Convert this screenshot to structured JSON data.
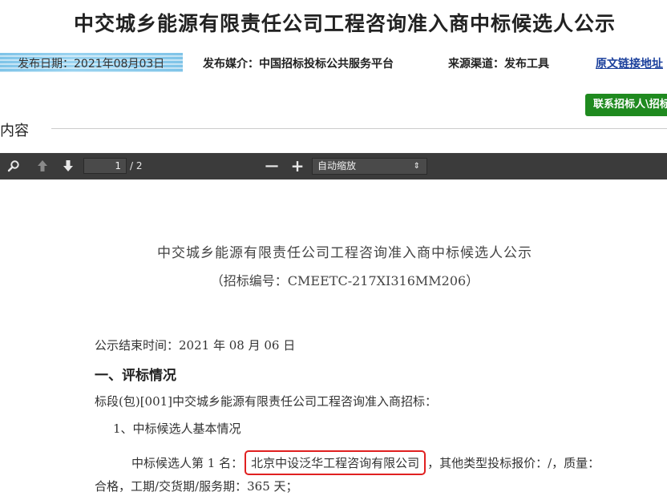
{
  "header": {
    "title": "中交城乡能源有限责任公司工程咨询准入商中标候选人公示",
    "publish_date": "发布日期：2021年08月03日",
    "media": "发布媒介：中国招标投标公共服务平台",
    "source": "来源渠道：发布工具",
    "original_link": "原文链接地址",
    "contact_button": "联系招标人\\招标",
    "section_label": "内容"
  },
  "pdf_toolbar": {
    "current_page": "1",
    "total_pages": "/ 2",
    "zoom": "自动缩放",
    "icons": [
      "search-icon",
      "previous-page-icon",
      "next-page-icon",
      "zoom-out-icon",
      "zoom-in-icon",
      "chevron-updown-icon"
    ],
    "zoom_out_symbol": "—",
    "zoom_in_symbol": "+"
  },
  "document": {
    "title": "中交城乡能源有限责任公司工程咨询准入商中标候选人公示",
    "code": "（招标编号：CMEETC-217XI316MM206）",
    "notice_end": "公示结束时间：2021 年 08 月 06 日",
    "heading_1": "一、评标情况",
    "section_line": "标段(包)[001]中交城乡能源有限责任公司工程咨询准入商招标：",
    "sub_heading": "1、中标候选人基本情况",
    "candidate_prefix": "中标候选人第 1 名：",
    "candidate_name": "北京中设泛华工程咨询有限公司",
    "candidate_suffix": "，其他类型投标报价：/，质量：",
    "term_line": "合格，工期/交货期/服务期：365 天；"
  },
  "colors": {
    "contact_button": "#1f8a1f",
    "toolbar": "#3b3b3b",
    "highlight_box": "#e02020",
    "link": "#1a3f9c",
    "wave": "#7fc4e8"
  }
}
